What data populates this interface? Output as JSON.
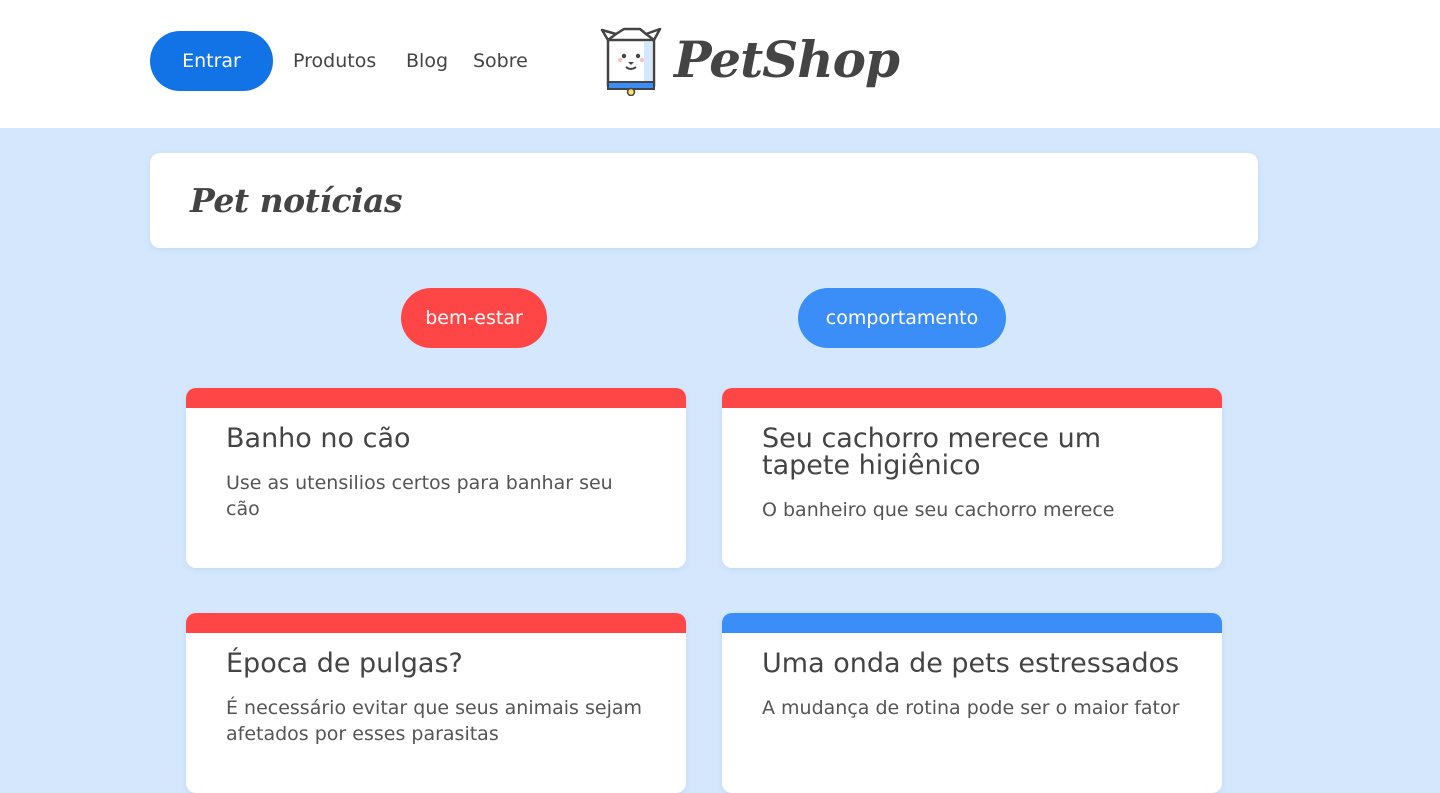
{
  "header": {
    "login_label": "Entrar",
    "nav": [
      {
        "label": "Produtos"
      },
      {
        "label": "Blog"
      },
      {
        "label": "Sobre"
      }
    ],
    "logo_text": "PetShop",
    "logo_icon": "dog-box-icon"
  },
  "page": {
    "title": "Pet notícias"
  },
  "categories": [
    {
      "label": "bem-estar",
      "color": "#ff4646"
    },
    {
      "label": "comportamento",
      "color": "#3b8ef7"
    }
  ],
  "posts": [
    {
      "title": "Banho no cão",
      "description": "Use as utensilios certos para banhar seu cão",
      "category_color": "#ff4646"
    },
    {
      "title": "Seu cachorro merece um tapete higiênico",
      "description": "O banheiro que seu cachorro merece",
      "category_color": "#ff4646"
    },
    {
      "title": "Época de pulgas?",
      "description": "É necessário evitar que seus animais sejam afetados por esses parasitas",
      "category_color": "#ff4646"
    },
    {
      "title": "Uma onda de pets estressados",
      "description": "A mudança de rotina pode ser o maior fator",
      "category_color": "#3b8ef7"
    }
  ],
  "colors": {
    "background": "#d4e7fc",
    "primary_button": "#1273e6",
    "text": "#444444"
  }
}
